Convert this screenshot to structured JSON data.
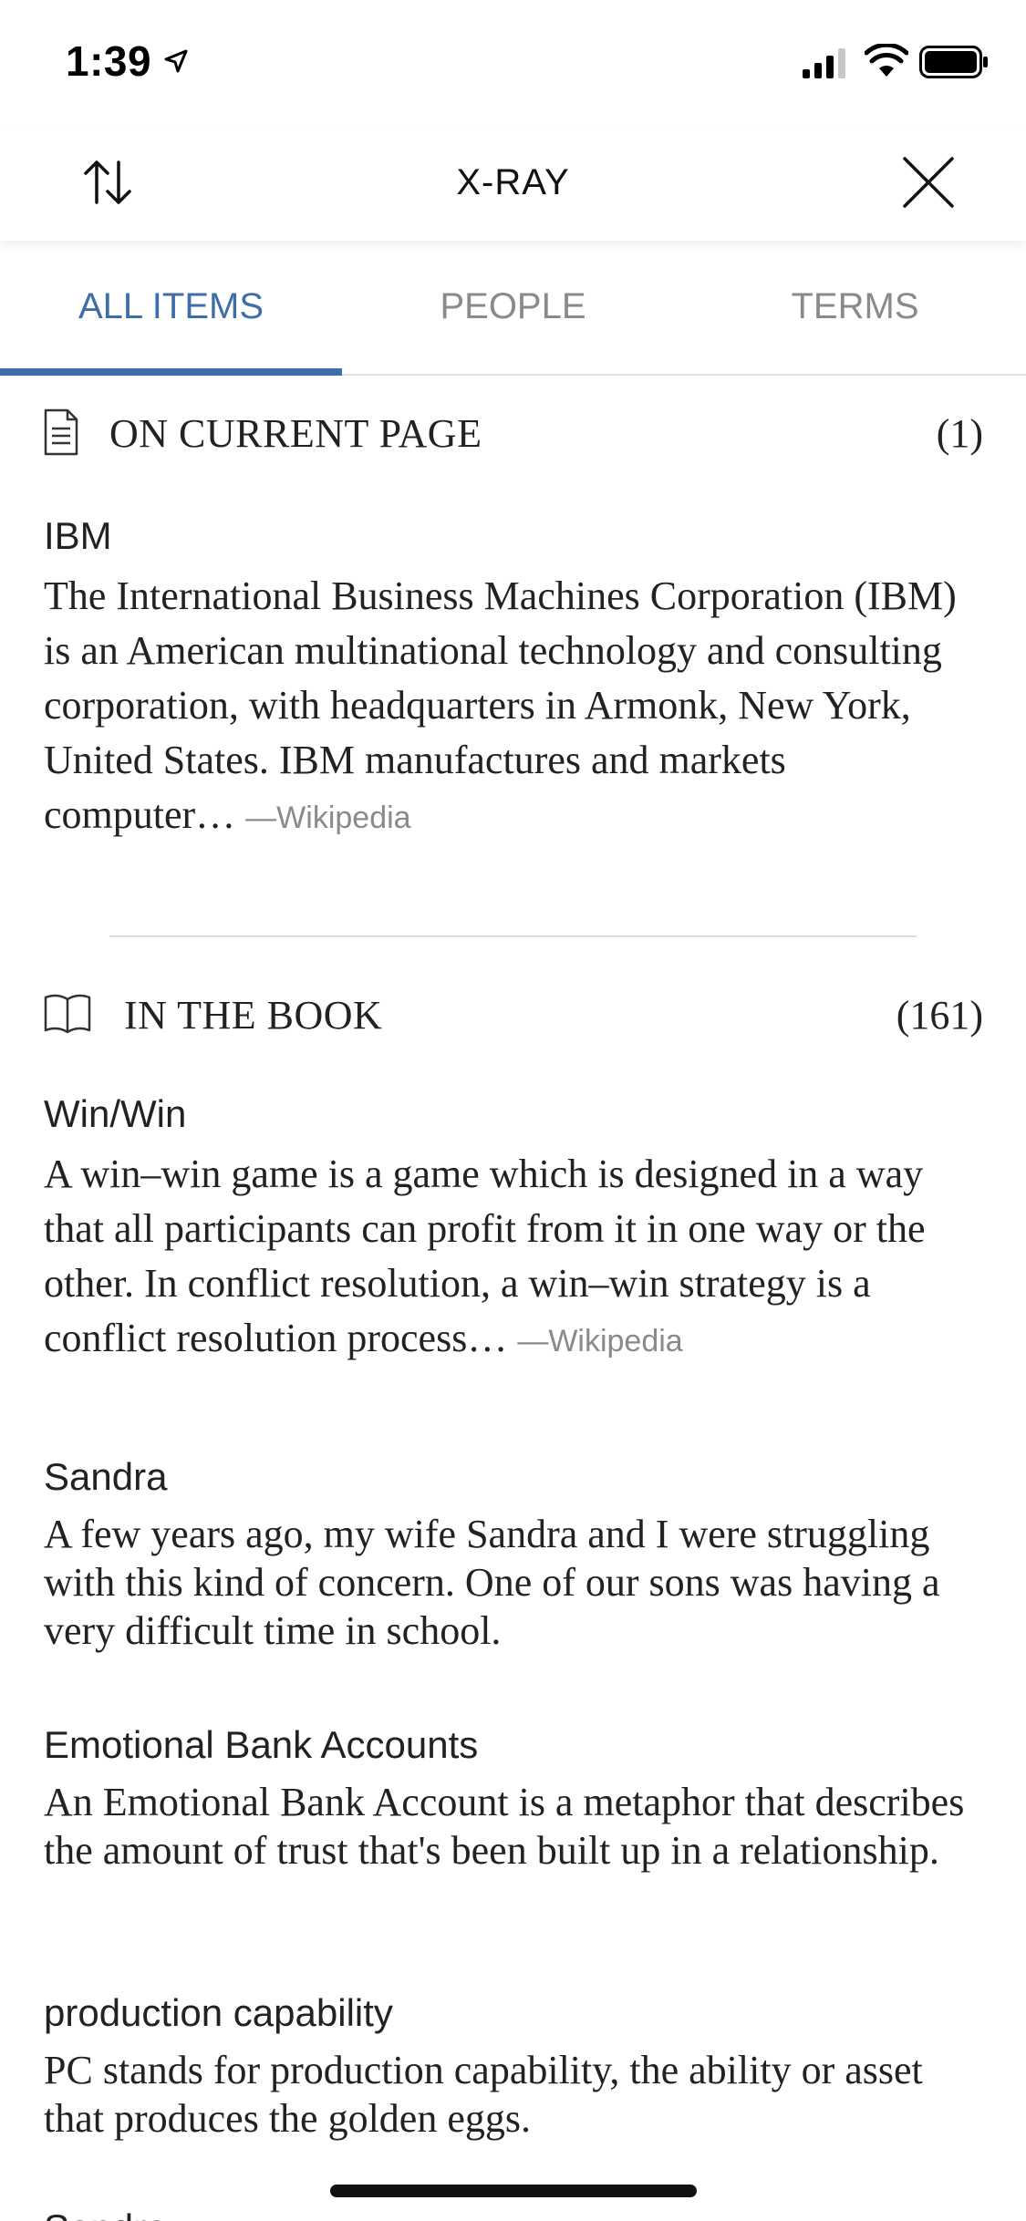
{
  "status": {
    "time": "1:39"
  },
  "nav": {
    "title": "X-RAY"
  },
  "tabs": [
    {
      "label": "ALL ITEMS"
    },
    {
      "label": "PEOPLE"
    },
    {
      "label": "TERMS"
    }
  ],
  "current_page": {
    "title": "ON CURRENT PAGE",
    "count": "(1)",
    "items": [
      {
        "title": "IBM",
        "desc": "The International Business Machines Corporation (IBM) is an American multinational technology and consulting corporation, with headquarters in Armonk, New York, United States. IBM manufactures and markets computer…",
        "source": "—Wikipedia"
      }
    ]
  },
  "book": {
    "title": "IN THE BOOK",
    "count": "(161)",
    "items": [
      {
        "title": "Win/Win",
        "desc": "A win–win game is a game which is designed in a way that all participants can profit from it in one way or the other. In conflict resolution, a win–win strategy is a conflict resolution process…",
        "source": "—Wikipedia"
      },
      {
        "title": "Sandra",
        "desc": "A few years ago, my wife Sandra and I were struggling with this kind of concern. One of our sons was having a very difficult time in school."
      },
      {
        "title": "Emotional Bank Accounts",
        "desc": "An Emotional Bank Account is a metaphor that describes the amount of trust that's been built up in a relationship."
      },
      {
        "title": "production capability",
        "desc": "PC stands for production capability, the ability or asset that produces the golden eggs."
      },
      {
        "title": "Sandra"
      }
    ]
  }
}
